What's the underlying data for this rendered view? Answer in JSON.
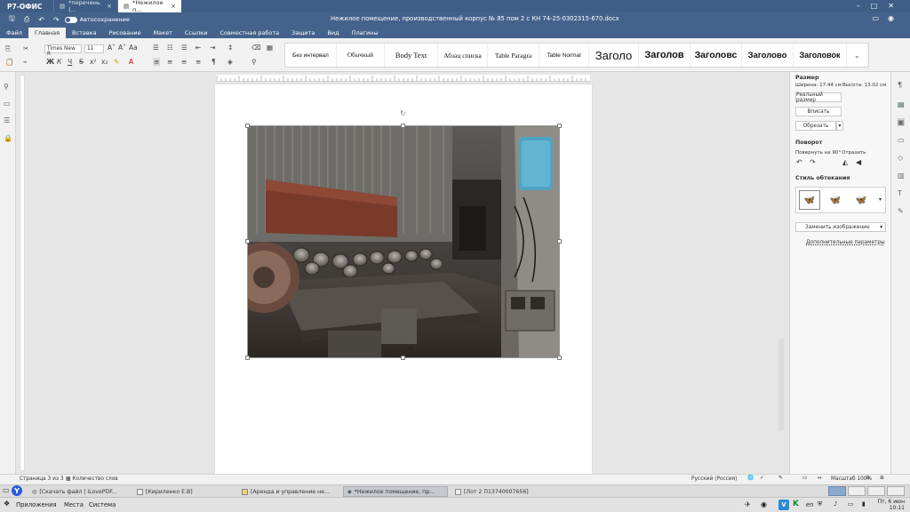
{
  "app": {
    "logo": "Р7-ОФИС"
  },
  "tabs": [
    {
      "label": "*перечень (...",
      "active": false
    },
    {
      "label": "*Нежилое п...",
      "active": true
    }
  ],
  "titlebar": {
    "autosave_label": "Автосохранение",
    "document_title": "Нежилое помещение, производственный корпус № 85 пом 2 с КН 74-25-0302315-670.docx"
  },
  "menu": [
    "Файл",
    "Главная",
    "Вставка",
    "Рисование",
    "Макет",
    "Ссылки",
    "Совместная работа",
    "Защита",
    "Вид",
    "Плагины"
  ],
  "menu_active": "Главная",
  "font": {
    "name": "Times New R",
    "size": "11"
  },
  "styles": [
    {
      "label": "Без интервал"
    },
    {
      "label": "Обычный"
    },
    {
      "label": "Body Text"
    },
    {
      "label": "Абзац списка"
    },
    {
      "label": "Table Paragra"
    },
    {
      "label": "Table Normal"
    },
    {
      "label": "Заголо"
    },
    {
      "label": "Заголов"
    },
    {
      "label": "Заголовс"
    },
    {
      "label": "Заголово"
    },
    {
      "label": "Заголовок"
    }
  ],
  "right_panel": {
    "size_title": "Размер",
    "width_label": "Ширина: 17.44 см",
    "height_label": "Высота: 13.02 см",
    "actual_size_btn": "Реальный размер",
    "fit_btn": "Вписать",
    "crop_btn": "Обрезать",
    "rotation_title": "Поворот",
    "rotate_label": "Повернуть на 90°",
    "flip_label": "Отразить",
    "wrap_title": "Стиль обтекания",
    "replace_btn": "Заменить изображение",
    "advanced_link": "Дополнительные параметры"
  },
  "status": {
    "page": "Страница 3 из 3",
    "word_count": "Количество слов",
    "language": "Русский (Россия)",
    "zoom": "Масштаб 100%"
  },
  "taskbar": [
    {
      "label": "[Скачать файл | iLovePDF...",
      "active": false
    },
    {
      "label": "[Кириленко Е.В]",
      "active": false
    },
    {
      "label": "[Аренда и управление не...",
      "active": false
    },
    {
      "label": "*Нежилое помещение, пр...",
      "active": true
    },
    {
      "label": "[Лот 2 П13740007656]",
      "active": false
    }
  ],
  "panel": {
    "apps": "Приложения",
    "places": "Места",
    "system": "Система",
    "lang": "en",
    "date": "Пт, 6 июн",
    "time": "10:11"
  },
  "colors": {
    "brand": "#44628b",
    "tab_dark": "#3f5d86"
  }
}
